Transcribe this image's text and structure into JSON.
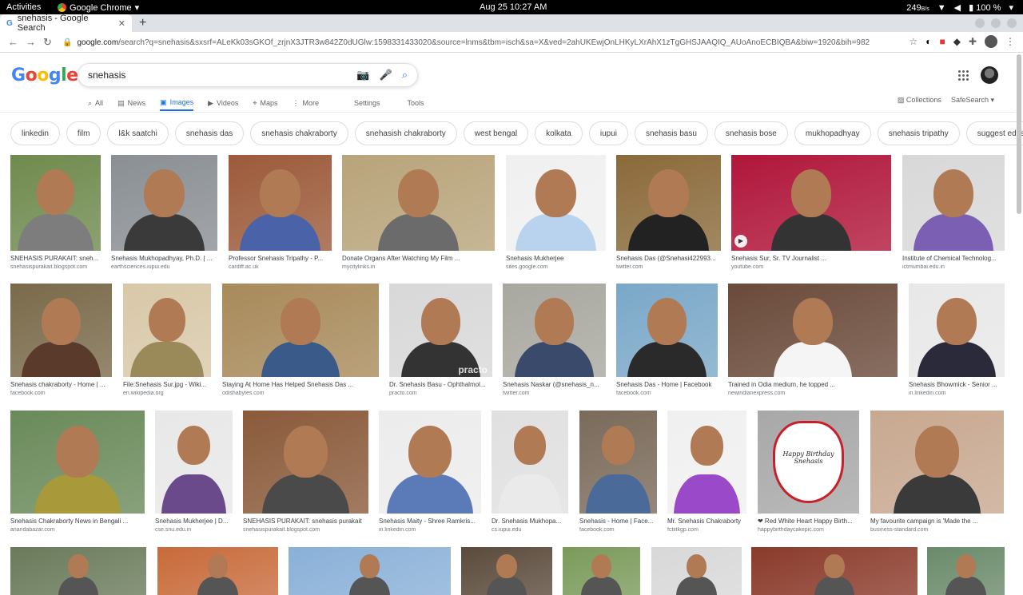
{
  "system": {
    "activities": "Activities",
    "app_name": "Google Chrome",
    "clock": "Aug 25  10:27 AM",
    "net_speed": "249",
    "net_unit": "B/s",
    "battery": "100 %"
  },
  "browser": {
    "tab_title": "snehasis - Google Search",
    "url_host": "google.com",
    "url_rest": "/search?q=snehasis&sxsrf=ALeKk03sGKOf_zrjnX3JTR3w842Z0dUGlw:1598331433020&source=lnms&tbm=isch&sa=X&ved=2ahUKEwjOnLHKyLXrAhX1zTgGHSJAAQIQ_AUoAnoECBIQBA&biw=1920&bih=982"
  },
  "search": {
    "query": "snehasis",
    "menu": [
      "All",
      "News",
      "Images",
      "Videos",
      "Maps",
      "More"
    ],
    "settings": "Settings",
    "tools": "Tools",
    "collections": "Collections",
    "safesearch": "SafeSearch"
  },
  "chips": [
    "linkedin",
    "film",
    "l&k saatchi",
    "snehasis das",
    "snehasis chakraborty",
    "snehasish chakraborty",
    "west bengal",
    "kolkata",
    "iupui",
    "snehasis basu",
    "snehasis bose",
    "mukhopadhyay",
    "snehasis tripathy",
    "suggest edits"
  ],
  "results": [
    {
      "title": "SNEHASIS PURAKAIT: sneh...",
      "source": "snehasispurakait.blogspot.com",
      "bg": "#6f8a4e",
      "shirt": "#7d7d7d"
    },
    {
      "title": "Snehasis Mukhopadhyay, Ph.D. | ...",
      "source": "earthsciences.iupui.edu",
      "bg": "#8a8f94",
      "shirt": "#3a3a3a"
    },
    {
      "title": "Professor Snehasis Tripathy - P...",
      "source": "cardiff.ac.uk",
      "bg": "#9c5a3a",
      "shirt": "#4a63a8"
    },
    {
      "title": "Donate Organs After Watching My Film ...",
      "source": "mycitylinks.in",
      "bg": "#b8a47a",
      "shirt": "#6b6b6b"
    },
    {
      "title": "Snehasis Mukherjee",
      "source": "sites.google.com",
      "bg": "#f0f0f0",
      "shirt": "#b9d2ee"
    },
    {
      "title": "Snehasis Das (@Snehasi422993...",
      "source": "twitter.com",
      "bg": "#8a6a3a",
      "shirt": "#222222"
    },
    {
      "title": "Snehasis Sur, Sr. TV Journalist ...",
      "source": "youtube.com",
      "bg": "#b0163a",
      "shirt": "#333333"
    },
    {
      "title": "Institute of Chemical Technolog...",
      "source": "ictmumbai.edu.in",
      "bg": "#d8d8d8",
      "shirt": "#7a5fb3"
    },
    {
      "title": "Snehasis chakraborty - Home | ...",
      "source": "facebook.com",
      "bg": "#7a6a4a",
      "shirt": "#5a3a2a"
    },
    {
      "title": "File:Snehasis Sur.jpg - Wiki...",
      "source": "en.wikipedia.org",
      "bg": "#d8c8a8",
      "shirt": "#9a8a5a"
    },
    {
      "title": "Staying At Home Has Helped Snehasis Das ...",
      "source": "odishabytes.com",
      "bg": "#a88a5a",
      "shirt": "#3a5a8a"
    },
    {
      "title": "Dr. Snehasis Basu - Ophthalmol...",
      "source": "practo.com",
      "bg": "#d8d8d8",
      "shirt": "#333333"
    },
    {
      "title": "Snehasis Naskar (@snehasis_n...",
      "source": "twitter.com",
      "bg": "#a8a8a0",
      "shirt": "#3a4a6a"
    },
    {
      "title": "Snehasis Das - Home | Facebook",
      "source": "facebook.com",
      "bg": "#7aa8c8",
      "shirt": "#2a2a2a"
    },
    {
      "title": "Trained in Odia medium, he topped ...",
      "source": "newindianexpress.com",
      "bg": "#6a4a3a",
      "shirt": "#f5f5f5"
    },
    {
      "title": "Snehasis Bhowmick - Senior ...",
      "source": "in.linkedin.com",
      "bg": "#e8e8e8",
      "shirt": "#2a2a3a"
    },
    {
      "title": "Snehasis Chakraborty News in Bengali ...",
      "source": "anandabazar.com",
      "bg": "#6a8a5a",
      "shirt": "#a89a3a"
    },
    {
      "title": "Snehasis Mukherjee | D...",
      "source": "cse.snu.edu.in",
      "bg": "#e8e8e8",
      "shirt": "#6a4a8a"
    },
    {
      "title": "SNEHASIS PURAKAIT: snehasis purakait",
      "source": "snehasispurakait.blogspot.com",
      "bg": "#8a5a3a",
      "shirt": "#4a4a4a"
    },
    {
      "title": "Snehasis Maity - Shree Ramkris...",
      "source": "in.linkedin.com",
      "bg": "#ececec",
      "shirt": "#5a7ab8"
    },
    {
      "title": "Dr. Snehasis Mukhopa...",
      "source": "cs.iupui.edu",
      "bg": "#e0e0e0",
      "shirt": "#eaeaea"
    },
    {
      "title": "Snehasis - Home | Face...",
      "source": "facebook.com",
      "bg": "#7a6a5a",
      "shirt": "#4a6a9a"
    },
    {
      "title": "Mr. Snehasis Chakraborty",
      "source": "fctiitkgp.com",
      "bg": "#f0f0f0",
      "shirt": "#9a4ac8"
    },
    {
      "title": "❤ Red White Heart Happy Birth...",
      "source": "happybirthdaycakepic.com",
      "bg": "#a8a8a8",
      "shirt": "#ffffff"
    },
    {
      "title": "My favourite campaign is 'Made the ...",
      "source": "business-standard.com",
      "bg": "#c8a890",
      "shirt": "#3a3a3a"
    },
    {
      "title": "",
      "source": "",
      "bg": "#6a7a5a",
      "shirt": "#555555"
    },
    {
      "title": "",
      "source": "",
      "bg": "#c86a3a",
      "shirt": "#555555"
    },
    {
      "title": "",
      "source": "",
      "bg": "#8ab0d8",
      "shirt": "#555555"
    },
    {
      "title": "",
      "source": "",
      "bg": "#5a4a3a",
      "shirt": "#555555"
    },
    {
      "title": "",
      "source": "",
      "bg": "#7a9a5a",
      "shirt": "#555555"
    },
    {
      "title": "",
      "source": "",
      "bg": "#d8d8d8",
      "shirt": "#555555"
    },
    {
      "title": "",
      "source": "",
      "bg": "#8a3a2a",
      "shirt": "#555555"
    },
    {
      "title": "",
      "source": "",
      "bg": "#6a8a6a",
      "shirt": "#555555"
    }
  ],
  "cake_text": "Happy Birthday Snehasis",
  "practo_watermark": "practo"
}
